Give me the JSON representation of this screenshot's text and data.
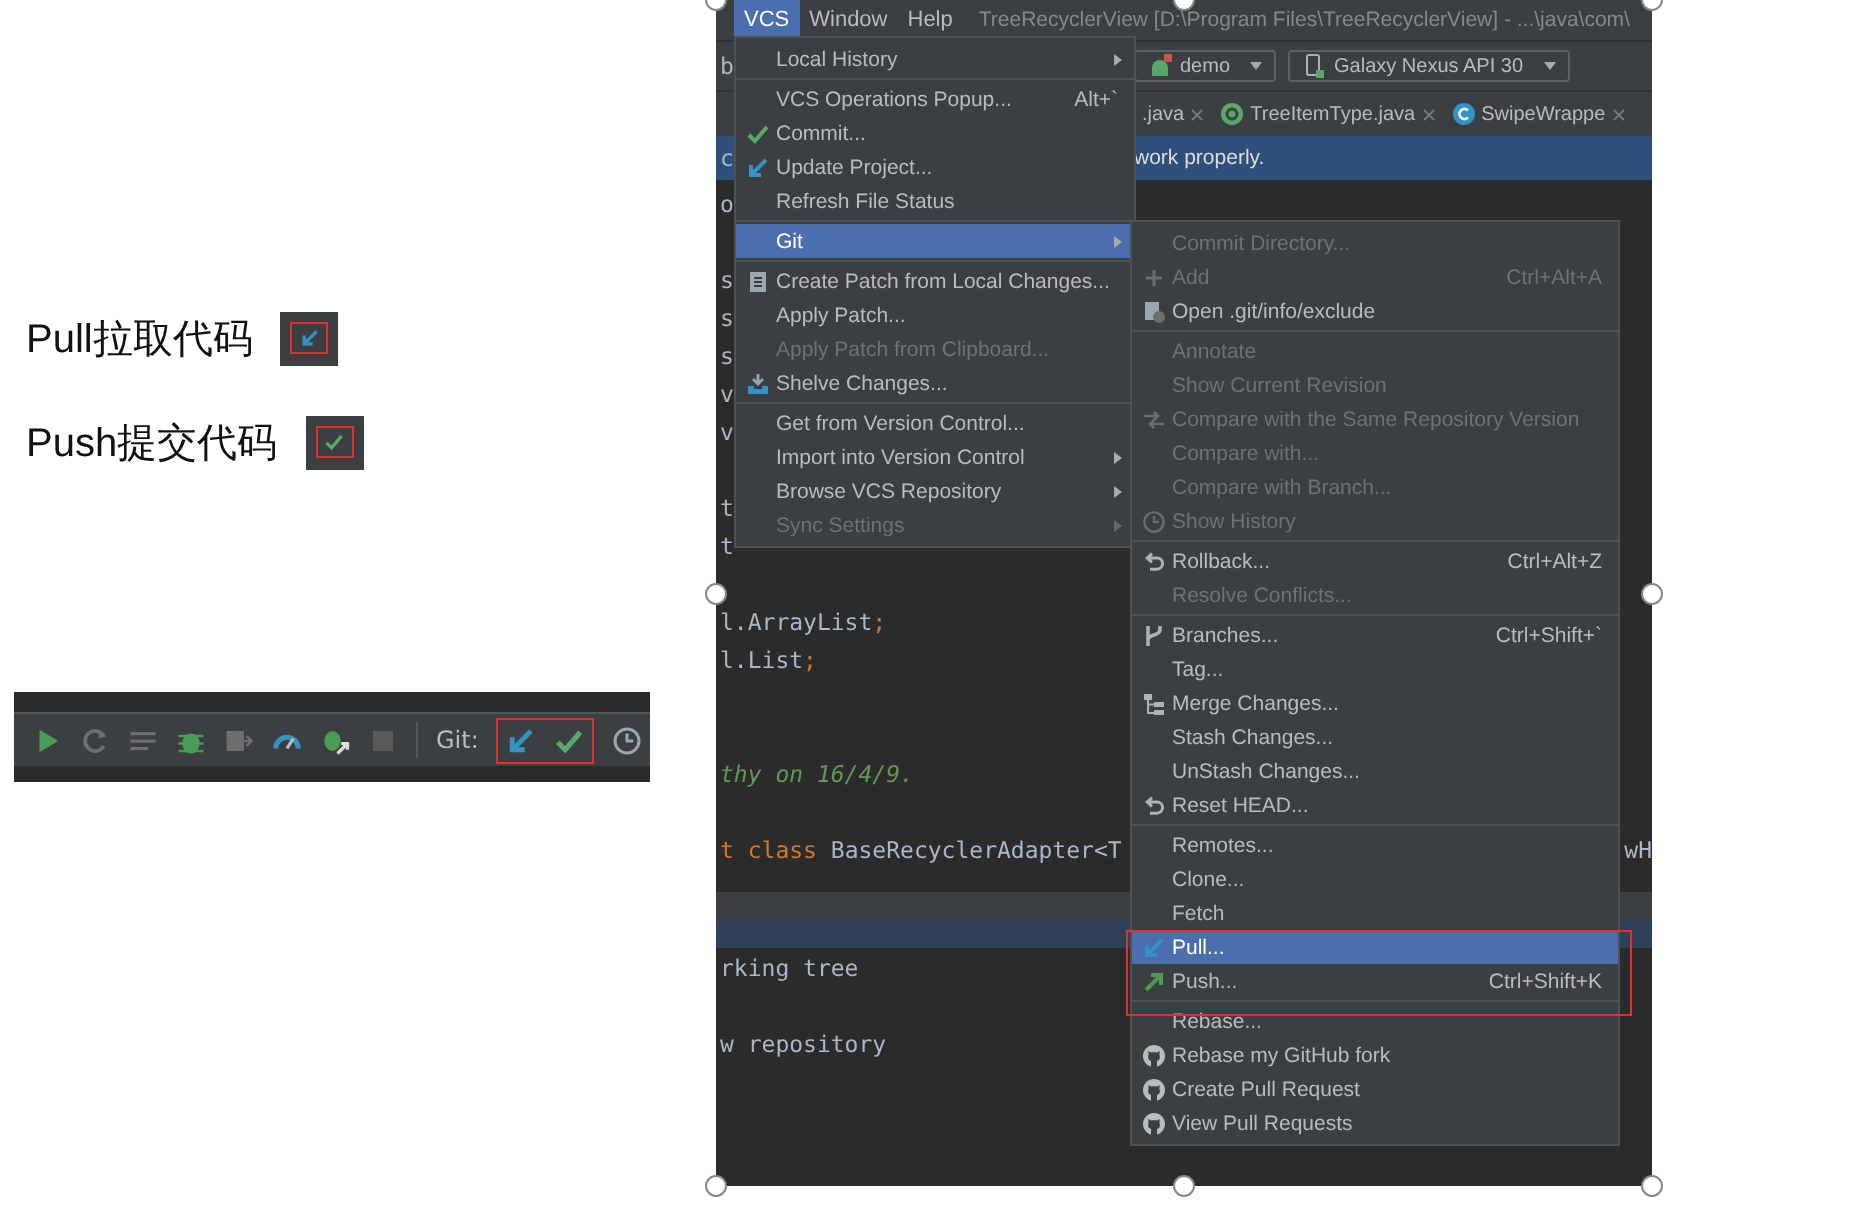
{
  "notes": [
    {
      "label": "Pull拉取代码"
    },
    {
      "label": "Push提交代码"
    }
  ],
  "toolbar_strip": {
    "git_label": "Git:"
  },
  "screenshot": {
    "menubar": {
      "items": [
        {
          "label": "VCS",
          "selected": true
        },
        {
          "label": "Window",
          "selected": false
        },
        {
          "label": "Help",
          "selected": false
        }
      ],
      "title": "TreeRecyclerView [D:\\Program Files\\TreeRecyclerView] - ...\\java\\com\\"
    },
    "toolbar": {
      "fragment": "b",
      "configs": [
        {
          "label": "demo"
        },
        {
          "label": "Galaxy Nexus API 30"
        }
      ]
    },
    "tabs": [
      {
        "label": ".java"
      },
      {
        "label": "TreeItemType.java"
      },
      {
        "label": "SwipeWrappe"
      }
    ],
    "notice": {
      "fragment": "c",
      "text": "work properly."
    },
    "editor": {
      "lines": [
        {
          "kind": "code",
          "segments": [
            {
              "text": "o",
              "kind": "code"
            }
          ]
        },
        {
          "kind": "blank"
        },
        {
          "kind": "code",
          "segments": [
            {
              "text": "s",
              "kind": "code"
            }
          ]
        },
        {
          "kind": "code",
          "segments": [
            {
              "text": "s",
              "kind": "code"
            }
          ]
        },
        {
          "kind": "code",
          "segments": [
            {
              "text": "s",
              "kind": "code"
            }
          ]
        },
        {
          "kind": "code",
          "segments": [
            {
              "text": "v",
              "kind": "code"
            }
          ]
        },
        {
          "kind": "code",
          "segments": [
            {
              "text": "v",
              "kind": "code"
            }
          ]
        },
        {
          "kind": "blank"
        },
        {
          "kind": "code",
          "segments": [
            {
              "text": "t",
              "kind": "code"
            }
          ]
        },
        {
          "kind": "code",
          "segments": [
            {
              "text": "t",
              "kind": "code"
            }
          ]
        },
        {
          "kind": "blank"
        },
        {
          "kind": "code",
          "segments": [
            {
              "text": "l.ArrayList",
              "kind": "code"
            },
            {
              "text": ";",
              "kind": "punct"
            }
          ]
        },
        {
          "kind": "code",
          "segments": [
            {
              "text": "l.List",
              "kind": "code"
            },
            {
              "text": ";",
              "kind": "punct"
            }
          ]
        },
        {
          "kind": "blank"
        },
        {
          "kind": "blank"
        },
        {
          "kind": "code",
          "segments": [
            {
              "text": "thy on 16/4/9.",
              "kind": "comment"
            }
          ]
        },
        {
          "kind": "blank"
        },
        {
          "kind": "code",
          "segments": [
            {
              "text": "t ",
              "kind": "keyword"
            },
            {
              "text": "class ",
              "kind": "keyword"
            },
            {
              "text": "BaseRecyclerAdapter<T",
              "kind": "code"
            }
          ],
          "tail": "wH"
        }
      ]
    },
    "panel": {
      "lines": [
        {
          "kind": "code",
          "segments": [
            {
              "text": "rking tree",
              "kind": "code"
            }
          ]
        },
        {
          "kind": "blank"
        },
        {
          "kind": "code",
          "segments": [
            {
              "text": "w repository",
              "kind": "code"
            }
          ]
        }
      ]
    },
    "vcs_menu": {
      "items": [
        {
          "kind": "item",
          "label": "Local History",
          "selected": false,
          "disabled": false,
          "submenu": true
        },
        {
          "kind": "separator"
        },
        {
          "kind": "item",
          "label": "VCS Operations Popup...",
          "shortcut": "Alt+`",
          "selected": false,
          "disabled": false,
          "submenu": false
        },
        {
          "kind": "item",
          "label": "Commit...",
          "selected": false,
          "disabled": false,
          "submenu": false
        },
        {
          "kind": "item",
          "label": "Update Project...",
          "selected": false,
          "disabled": false,
          "submenu": false
        },
        {
          "kind": "item",
          "label": "Refresh File Status",
          "selected": false,
          "disabled": false,
          "submenu": false
        },
        {
          "kind": "separator"
        },
        {
          "kind": "item",
          "label": "Git",
          "selected": true,
          "disabled": false,
          "submenu": true
        },
        {
          "kind": "separator"
        },
        {
          "kind": "item",
          "label": "Create Patch from Local Changes...",
          "selected": false,
          "disabled": false,
          "submenu": false
        },
        {
          "kind": "item",
          "label": "Apply Patch...",
          "selected": false,
          "disabled": false,
          "submenu": false
        },
        {
          "kind": "item",
          "label": "Apply Patch from Clipboard...",
          "selected": false,
          "disabled": true,
          "submenu": false
        },
        {
          "kind": "item",
          "label": "Shelve Changes...",
          "selected": false,
          "disabled": false,
          "submenu": false
        },
        {
          "kind": "separator"
        },
        {
          "kind": "item",
          "label": "Get from Version Control...",
          "selected": false,
          "disabled": false,
          "submenu": false
        },
        {
          "kind": "item",
          "label": "Import into Version Control",
          "selected": false,
          "disabled": false,
          "submenu": true
        },
        {
          "kind": "item",
          "label": "Browse VCS Repository",
          "selected": false,
          "disabled": false,
          "submenu": true
        },
        {
          "kind": "item",
          "label": "Sync Settings",
          "selected": false,
          "disabled": true,
          "submenu": true
        }
      ]
    },
    "git_menu": {
      "items": [
        {
          "kind": "item",
          "label": "Commit Directory...",
          "selected": false,
          "disabled": true
        },
        {
          "kind": "item",
          "label": "Add",
          "shortcut": "Ctrl+Alt+A",
          "selected": false,
          "disabled": true
        },
        {
          "kind": "item",
          "label": "Open .git/info/exclude",
          "selected": false,
          "disabled": false
        },
        {
          "kind": "separator"
        },
        {
          "kind": "item",
          "label": "Annotate",
          "selected": false,
          "disabled": true
        },
        {
          "kind": "item",
          "label": "Show Current Revision",
          "selected": false,
          "disabled": true
        },
        {
          "kind": "item",
          "label": "Compare with the Same Repository Version",
          "selected": false,
          "disabled": true
        },
        {
          "kind": "item",
          "label": "Compare with...",
          "selected": false,
          "disabled": true
        },
        {
          "kind": "item",
          "label": "Compare with Branch...",
          "selected": false,
          "disabled": true
        },
        {
          "kind": "item",
          "label": "Show History",
          "selected": false,
          "disabled": true
        },
        {
          "kind": "separator"
        },
        {
          "kind": "item",
          "label": "Rollback...",
          "shortcut": "Ctrl+Alt+Z",
          "selected": false,
          "disabled": false
        },
        {
          "kind": "item",
          "label": "Resolve Conflicts...",
          "selected": false,
          "disabled": true
        },
        {
          "kind": "separator"
        },
        {
          "kind": "item",
          "label": "Branches...",
          "shortcut": "Ctrl+Shift+`",
          "selected": false,
          "disabled": false
        },
        {
          "kind": "item",
          "label": "Tag...",
          "selected": false,
          "disabled": false
        },
        {
          "kind": "item",
          "label": "Merge Changes...",
          "selected": false,
          "disabled": false
        },
        {
          "kind": "item",
          "label": "Stash Changes...",
          "selected": false,
          "disabled": false
        },
        {
          "kind": "item",
          "label": "UnStash Changes...",
          "selected": false,
          "disabled": false
        },
        {
          "kind": "item",
          "label": "Reset HEAD...",
          "selected": false,
          "disabled": false
        },
        {
          "kind": "separator"
        },
        {
          "kind": "item",
          "label": "Remotes...",
          "selected": false,
          "disabled": false
        },
        {
          "kind": "item",
          "label": "Clone...",
          "selected": false,
          "disabled": false
        },
        {
          "kind": "item",
          "label": "Fetch",
          "selected": false,
          "disabled": false
        },
        {
          "kind": "item",
          "label": "Pull...",
          "selected": true,
          "disabled": false
        },
        {
          "kind": "item",
          "label": "Push...",
          "shortcut": "Ctrl+Shift+K",
          "selected": false,
          "disabled": false
        },
        {
          "kind": "separator"
        },
        {
          "kind": "item",
          "label": "Rebase...",
          "selected": false,
          "disabled": false
        },
        {
          "kind": "item",
          "label": "Rebase my GitHub fork",
          "selected": false,
          "disabled": false
        },
        {
          "kind": "item",
          "label": "Create Pull Request",
          "selected": false,
          "disabled": false
        },
        {
          "kind": "item",
          "label": "View Pull Requests",
          "selected": false,
          "disabled": false
        }
      ]
    }
  }
}
